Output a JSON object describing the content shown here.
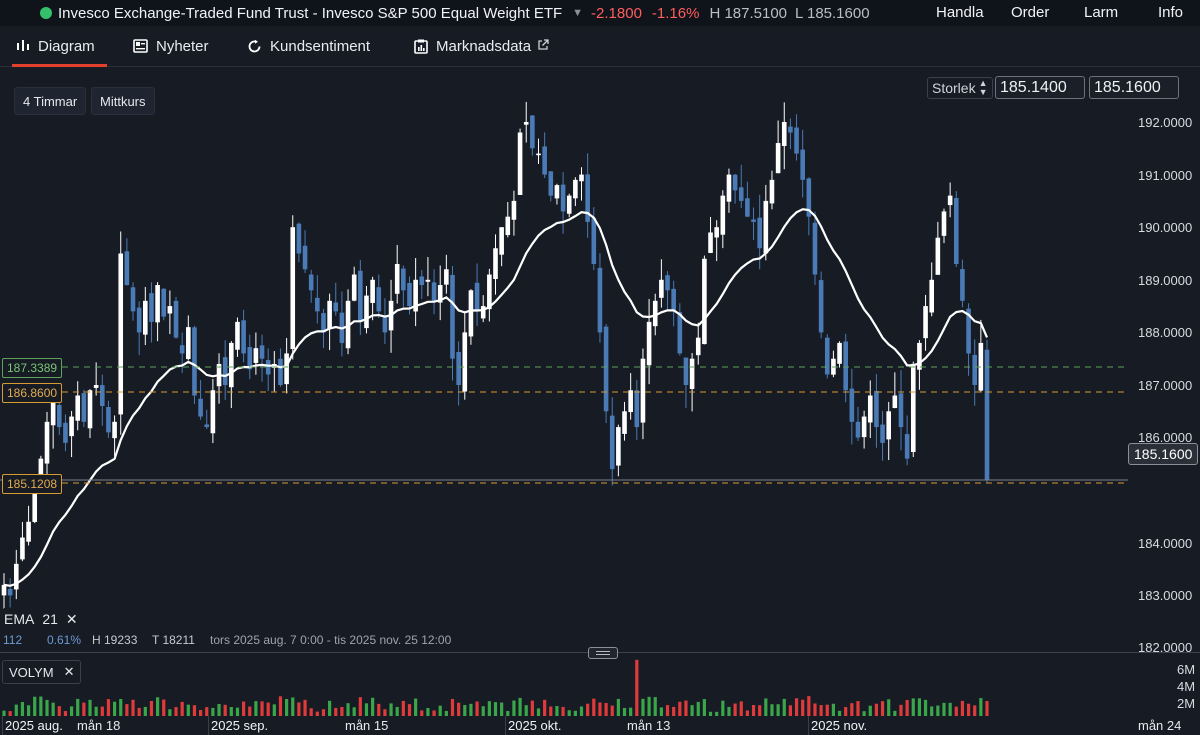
{
  "header": {
    "instrument": "Invesco Exchange-Traded Fund Trust - Invesco S&P 500 Equal Weight ETF",
    "change": "-2.1800",
    "change_pct": "-1.16%",
    "high": "H 187.5100",
    "low": "L 185.1600",
    "nav": [
      "Handla",
      "Order",
      "Larm",
      "Info"
    ]
  },
  "tabs": [
    "Diagram",
    "Nyheter",
    "Kundsentiment",
    "Marknadsdata"
  ],
  "toolbar": {
    "interval": "4 Timmar",
    "price_type": "Mittkurs",
    "size_label": "Storlek",
    "bid": "185.1400",
    "ask": "185.1600"
  },
  "y_axis": [
    "192.0000",
    "191.0000",
    "190.0000",
    "189.0000",
    "188.0000",
    "187.0000",
    "186.0000",
    "184.0000",
    "183.0000",
    "182.0000"
  ],
  "price_lines": [
    "187.3389",
    "186.8600",
    "185.1208"
  ],
  "current_price": "185.1600",
  "indicator": {
    "ema_label": "EMA",
    "ema_period": "21",
    "info_left": "112",
    "info_pct": "0.61%",
    "info_h": "H 19233",
    "info_t": "T 18211",
    "range": "tors 2025 aug. 7 0:00 - tis 2025 nov. 25 12:00"
  },
  "volume": {
    "label": "VOLYM",
    "y_axis": [
      "6M",
      "4M",
      "2M"
    ]
  },
  "x_axis": [
    "2025 aug.",
    "mån 18",
    "2025 sep.",
    "mån 15",
    "2025 okt.",
    "mån 13",
    "2025 nov.",
    "mån 24"
  ],
  "colors": {
    "up": "#ffffff",
    "down": "#4a7bb7",
    "ema": "#ffffff",
    "vol_up": "#3aa64a",
    "vol_down": "#e03b3b",
    "accent": "#e2402d"
  },
  "chart_data": {
    "type": "candlestick",
    "y_range": [
      182,
      192.5
    ],
    "ema_period": 21,
    "close_path": [
      183.2,
      183.0,
      183.6,
      184.1,
      184.4,
      185.0,
      185.6,
      186.3,
      186.7,
      186.2,
      185.9,
      186.4,
      186.8,
      186.3,
      186.9,
      187.0,
      186.6,
      186.1,
      186.3,
      189.5,
      188.9,
      188.4,
      188.0,
      188.6,
      188.2,
      188.9,
      188.3,
      188.5,
      187.9,
      187.6,
      188.1,
      186.8,
      186.4,
      186.2,
      186.9,
      187.4,
      187.0,
      187.8,
      188.2,
      187.6,
      187.3,
      187.7,
      187.5,
      187.2,
      187.4,
      187.0,
      187.6,
      190.0,
      189.5,
      189.2,
      188.8,
      188.4,
      188.0,
      188.6,
      188.4,
      187.8,
      188.6,
      189.1,
      188.2,
      188.7,
      189.0,
      188.4,
      188.0,
      188.6,
      189.3,
      188.8,
      188.5,
      189.0,
      188.9,
      189.0,
      188.6,
      188.9,
      189.2,
      187.5,
      187.0,
      188.0,
      188.8,
      188.4,
      188.5,
      189.1,
      189.6,
      190.0,
      190.2,
      190.5,
      191.8,
      192.0,
      191.5,
      191.4,
      191.0,
      190.6,
      190.8,
      190.3,
      190.6,
      190.9,
      191.0,
      190.1,
      189.3,
      188.0,
      186.5,
      185.4,
      186.2,
      186.5,
      186.9,
      186.2,
      187.5,
      188.2,
      188.6,
      189.0,
      188.8,
      188.4,
      187.6,
      187.0,
      187.5,
      187.9,
      189.4,
      189.9,
      190.0,
      190.6,
      191.0,
      190.7,
      190.5,
      190.2,
      190.1,
      189.6,
      190.5,
      190.9,
      191.6,
      192.0,
      191.8,
      191.4,
      190.9,
      190.2,
      189.1,
      188.0,
      187.2,
      187.5,
      187.8,
      186.9,
      186.3,
      186.0,
      186.4,
      186.8,
      186.2,
      185.9,
      186.5,
      186.8,
      186.2,
      185.6,
      187.4,
      187.8,
      188.5,
      189.0,
      189.8,
      190.3,
      190.6,
      189.3,
      188.6,
      187.6,
      187.0,
      187.8,
      185.2
    ]
  }
}
